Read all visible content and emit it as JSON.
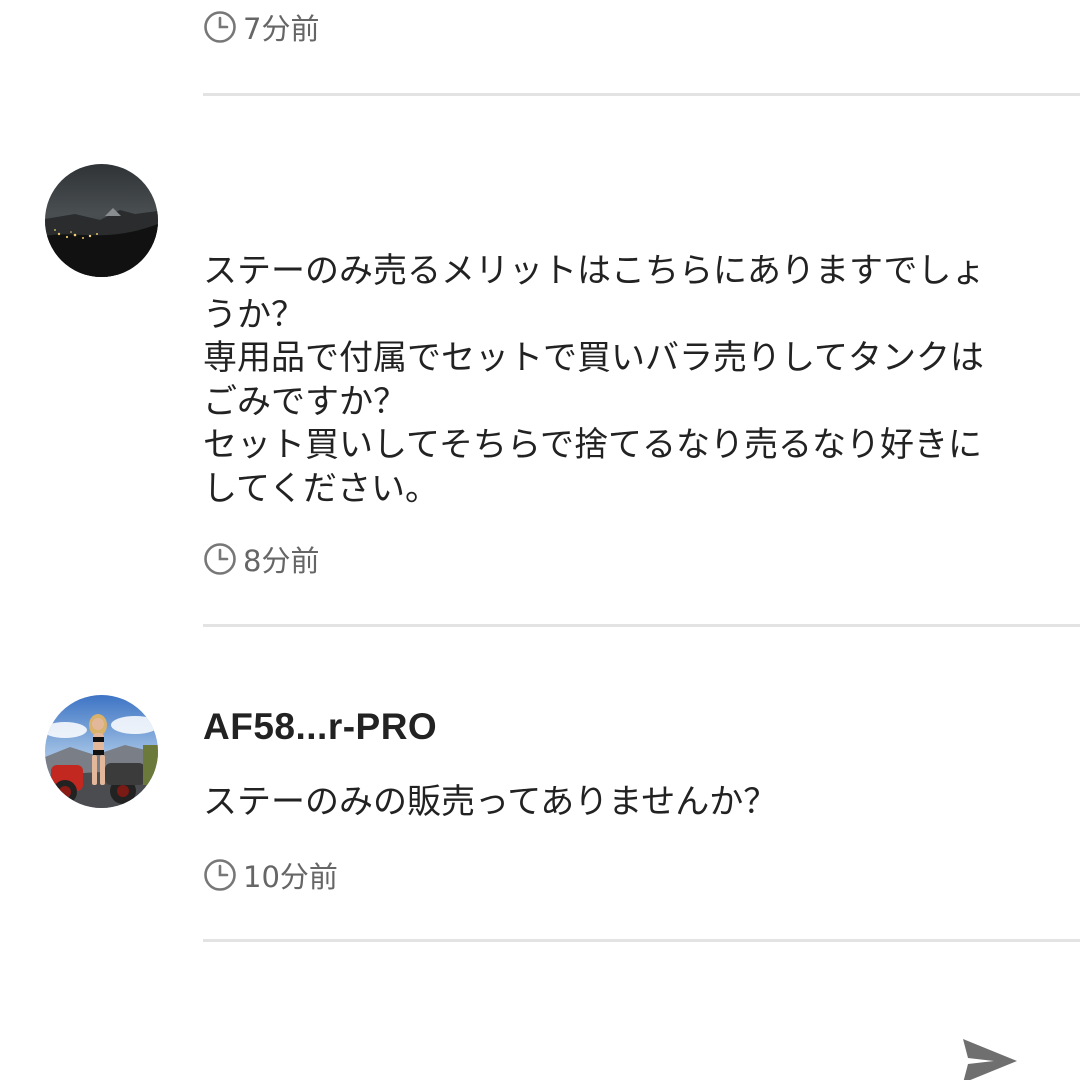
{
  "comments": [
    {
      "timestamp": "7分前"
    },
    {
      "username": "",
      "avatar_icon": "night-landscape-avatar",
      "message_lines": [
        "ステーのみ売るメリットはこちらにありますでしょ",
        "うか？",
        "専用品で付属でセットで買いバラ売りしてタンクは",
        "ごみですか？",
        "セット買いしてそちらで捨てるなり売るなり好きに",
        "してください。"
      ],
      "timestamp": "8分前"
    },
    {
      "username": "AF58...r-PRO",
      "avatar_icon": "motorcycle-photo-avatar",
      "message_lines": [
        "ステーのみの販売ってありませんか？"
      ],
      "timestamp": "10分前"
    }
  ],
  "icons": {
    "clock": "clock-icon",
    "send": "send-icon"
  },
  "colors": {
    "text": "#222222",
    "muted": "#666666",
    "divider": "#e3e3e3"
  }
}
